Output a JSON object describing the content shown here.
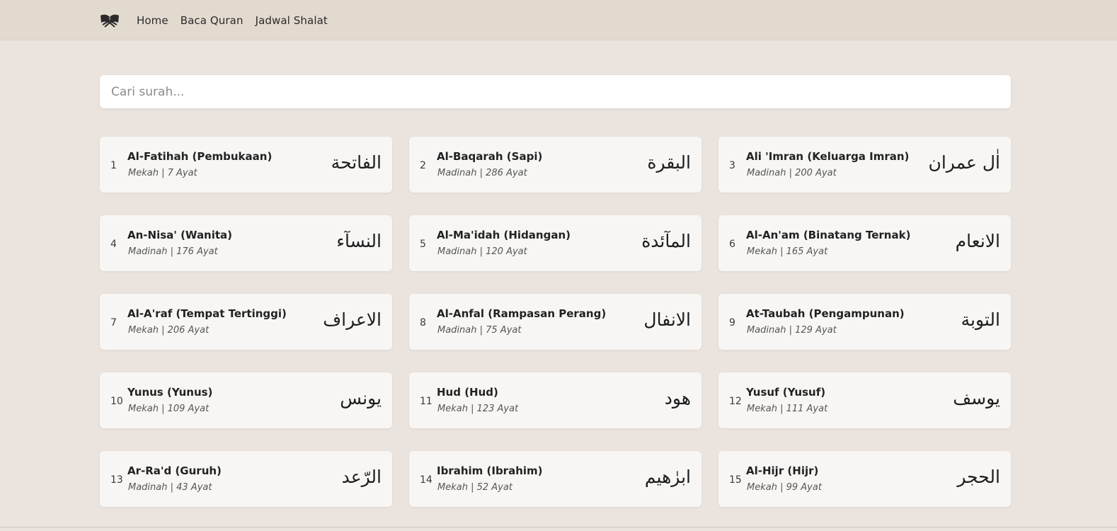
{
  "nav": {
    "logo_icon": "quran-book-icon",
    "links": [
      "Home",
      "Baca Quran",
      "Jadwal Shalat"
    ]
  },
  "search": {
    "placeholder": "Cari surah...",
    "value": ""
  },
  "surahs": [
    {
      "number": "1",
      "name": "Al-Fatihah (Pembukaan)",
      "meta": "Mekah | 7 Ayat",
      "arabic": "الفاتحة"
    },
    {
      "number": "2",
      "name": "Al-Baqarah (Sapi)",
      "meta": "Madinah | 286 Ayat",
      "arabic": "البقرة"
    },
    {
      "number": "3",
      "name": "Ali 'Imran (Keluarga Imran)",
      "meta": "Madinah | 200 Ayat",
      "arabic": "اٰل عمران"
    },
    {
      "number": "4",
      "name": "An-Nisa' (Wanita)",
      "meta": "Madinah | 176 Ayat",
      "arabic": "النسآء"
    },
    {
      "number": "5",
      "name": "Al-Ma'idah (Hidangan)",
      "meta": "Madinah | 120 Ayat",
      "arabic": "المآئدة"
    },
    {
      "number": "6",
      "name": "Al-An'am (Binatang Ternak)",
      "meta": "Mekah | 165 Ayat",
      "arabic": "الانعام"
    },
    {
      "number": "7",
      "name": "Al-A'raf (Tempat Tertinggi)",
      "meta": "Mekah | 206 Ayat",
      "arabic": "الاعراف"
    },
    {
      "number": "8",
      "name": "Al-Anfal (Rampasan Perang)",
      "meta": "Madinah | 75 Ayat",
      "arabic": "الانفال"
    },
    {
      "number": "9",
      "name": "At-Taubah (Pengampunan)",
      "meta": "Madinah | 129 Ayat",
      "arabic": "التوبة"
    },
    {
      "number": "10",
      "name": "Yunus (Yunus)",
      "meta": "Mekah | 109 Ayat",
      "arabic": "يونس"
    },
    {
      "number": "11",
      "name": "Hud (Hud)",
      "meta": "Mekah | 123 Ayat",
      "arabic": "هود"
    },
    {
      "number": "12",
      "name": "Yusuf (Yusuf)",
      "meta": "Mekah | 111 Ayat",
      "arabic": "يوسف"
    },
    {
      "number": "13",
      "name": "Ar-Ra'd (Guruh)",
      "meta": "Madinah | 43 Ayat",
      "arabic": "الرّعد"
    },
    {
      "number": "14",
      "name": "Ibrahim (Ibrahim)",
      "meta": "Mekah | 52 Ayat",
      "arabic": "ابرٰهيم"
    },
    {
      "number": "15",
      "name": "Al-Hijr (Hijr)",
      "meta": "Mekah | 99 Ayat",
      "arabic": "الحجر"
    }
  ],
  "colors": {
    "navbar_bg": "#e3dacf",
    "page_bg": "#ebe3dd",
    "card_bg": "#f7f6f4"
  }
}
